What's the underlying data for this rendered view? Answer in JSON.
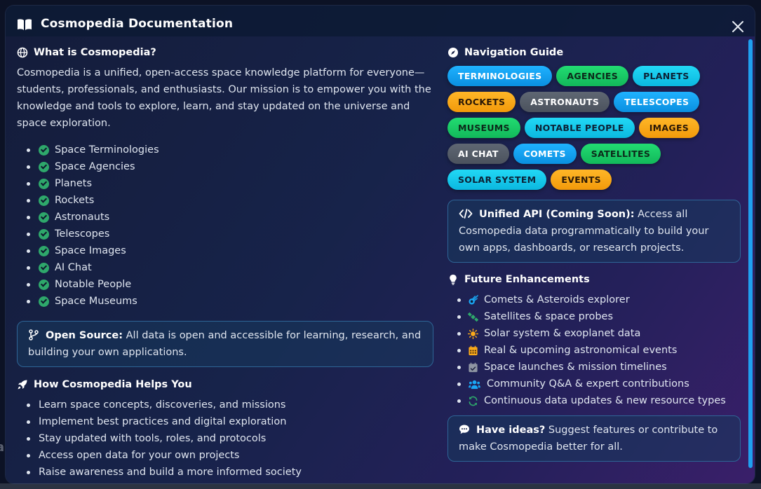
{
  "modal": {
    "title": "Cosmopedia Documentation"
  },
  "what": {
    "title": "What is Cosmopedia?",
    "description": "Cosmopedia is a unified, open-access space knowledge platform for everyone—students, professionals, and enthusiasts. Our mission is to empower you with the knowledge and tools to explore, learn, and stay updated on the universe and space exploration.",
    "features": [
      "Space Terminologies",
      "Space Agencies",
      "Planets",
      "Rockets",
      "Astronauts",
      "Telescopes",
      "Space Images",
      "AI Chat",
      "Notable People",
      "Space Museums"
    ]
  },
  "open_source": {
    "label": "Open Source:",
    "text": "All data is open and accessible for learning, research, and building your own applications."
  },
  "helps": {
    "title": "How Cosmopedia Helps You",
    "items": [
      "Learn space concepts, discoveries, and missions",
      "Implement best practices and digital exploration",
      "Stay updated with tools, roles, and protocols",
      "Access open data for your own projects",
      "Raise awareness and build a more informed society"
    ]
  },
  "navigation": {
    "title": "Navigation Guide",
    "chips": [
      {
        "label": "Terminologies",
        "color": "#1aa7f5"
      },
      {
        "label": "Agencies",
        "color": "#1bcf68"
      },
      {
        "label": "Planets",
        "color": "#16cdee"
      },
      {
        "label": "Rockets",
        "color": "#fbaa1a"
      },
      {
        "label": "Astronauts",
        "color": "#565d69"
      },
      {
        "label": "Telescopes",
        "color": "#1aa7f5"
      },
      {
        "label": "Museums",
        "color": "#1bcf68"
      },
      {
        "label": "Notable People",
        "color": "#16cdee"
      },
      {
        "label": "Images",
        "color": "#fbaa1a"
      },
      {
        "label": "AI Chat",
        "color": "#565d69"
      },
      {
        "label": "Comets",
        "color": "#1aa7f5"
      },
      {
        "label": "Satellites",
        "color": "#1bcf68"
      },
      {
        "label": "Solar System",
        "color": "#16cdee"
      },
      {
        "label": "Events",
        "color": "#fbaa1a"
      }
    ]
  },
  "api": {
    "label": "Unified API (Coming Soon):",
    "text": "Access all Cosmopedia data programmatically to build your own apps, dashboards, or research projects."
  },
  "future": {
    "title": "Future Enhancements",
    "items": [
      {
        "icon": "comet-icon",
        "text": "Comets & Asteroids explorer"
      },
      {
        "icon": "satellite-icon",
        "text": "Satellites & space probes"
      },
      {
        "icon": "sun-icon",
        "text": "Solar system & exoplanet data"
      },
      {
        "icon": "calendar-icon",
        "text": "Real & upcoming astronomical events"
      },
      {
        "icon": "calendar-check-icon",
        "text": "Space launches & mission timelines"
      },
      {
        "icon": "users-icon",
        "text": "Community Q&A & expert contributions"
      },
      {
        "icon": "refresh-icon",
        "text": "Continuous data updates & new resource types"
      }
    ]
  },
  "ideas": {
    "label": "Have ideas?",
    "text": "Suggest features or contribute to make Cosmopedia better for all."
  },
  "colors": {
    "accent": "#1aa7f5",
    "check": "#2ea86b",
    "box_border": "#2e6596"
  }
}
